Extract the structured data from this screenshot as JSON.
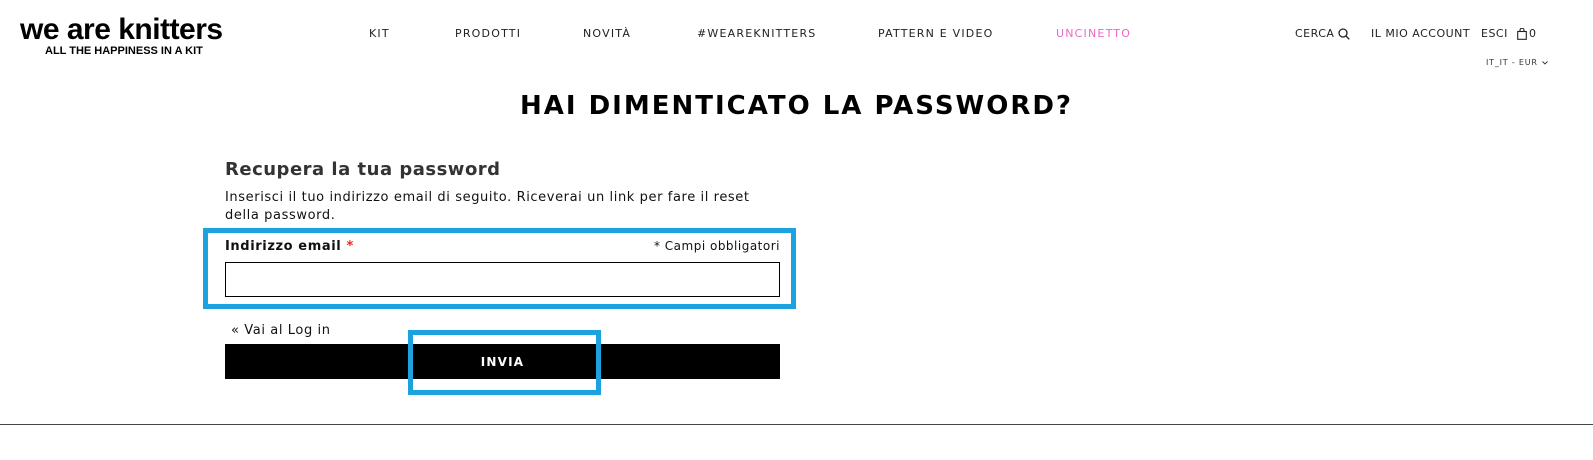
{
  "brand": {
    "name": "we are knitters",
    "tagline": "ALL THE HAPPINESS IN A KIT"
  },
  "nav": {
    "items": [
      {
        "label": "KIT"
      },
      {
        "label": "PRODOTTI"
      },
      {
        "label": "NOVITÀ"
      },
      {
        "label": "#WEAREKNITTERS"
      },
      {
        "label": "PATTERN E VIDEO"
      },
      {
        "label": "UNCINETTO"
      }
    ]
  },
  "header": {
    "search_label": "CERCA",
    "account_label": "IL MIO ACCOUNT",
    "logout_label": "ESCI",
    "cart_count": "0",
    "locale": "IT_IT - EUR"
  },
  "page": {
    "title": "HAI DIMENTICATO LA PASSWORD?",
    "section_title": "Recupera la tua password",
    "instructions": "Inserisci il tuo indirizzo email di seguito. Riceverai un link per fare il reset della password."
  },
  "form": {
    "email_label": "Indirizzo email",
    "required_star": "*",
    "required_note": "* Campi obbligatori",
    "email_value": "",
    "back_link": "« Vai al Log in",
    "submit_label": "INVIA"
  },
  "colors": {
    "accent_pink": "#e869c7",
    "highlight_blue": "#1aa3df",
    "required_red": "#e02b27"
  }
}
